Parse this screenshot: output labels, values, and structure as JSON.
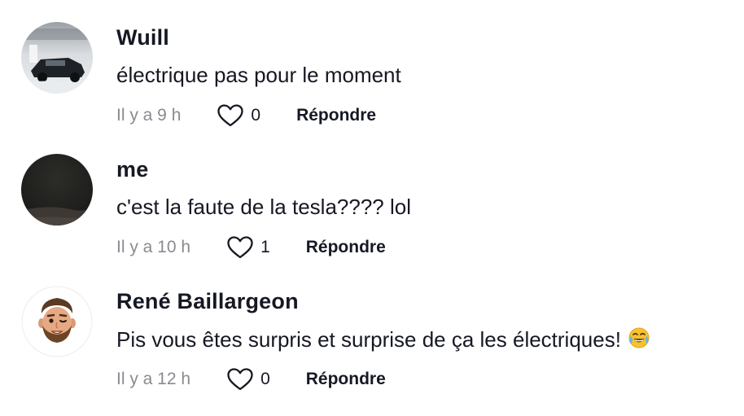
{
  "comments": [
    {
      "avatar_icon": "car-photo-avatar",
      "username": "Wuill",
      "text": "électrique pas pour le moment",
      "time": "Il y a 9 h",
      "likes": "0",
      "reply_label": "Répondre"
    },
    {
      "avatar_icon": "dark-photo-avatar",
      "username": "me",
      "text": "c'est la faute de la tesla???? lol",
      "time": "Il y a 10 h",
      "likes": "1",
      "reply_label": "Répondre"
    },
    {
      "avatar_icon": "memoji-avatar",
      "username": "René Baillargeon",
      "text": "Pis vous êtes surpris et surprise de ça les électriques!",
      "emoji": "tears-of-joy-emoji",
      "time": "Il y a 12 h",
      "likes": "0",
      "reply_label": "Répondre"
    }
  ],
  "colors": {
    "primary_text": "#161823",
    "secondary_text": "#8a8b91",
    "heart_outline": "#161823"
  }
}
